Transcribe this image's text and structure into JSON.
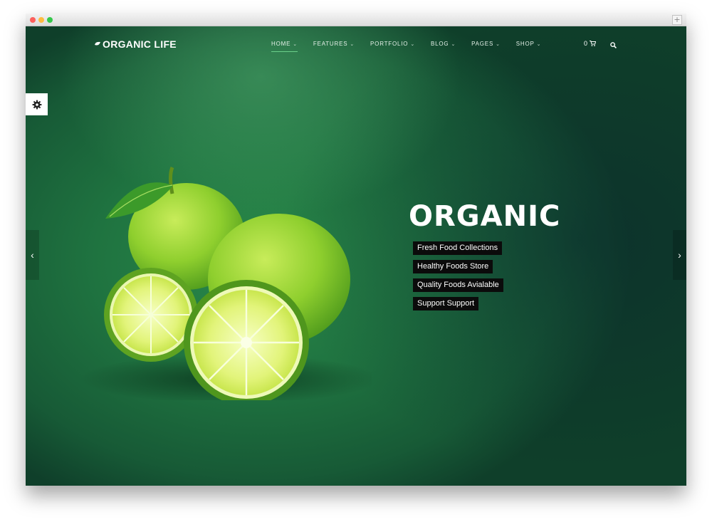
{
  "brand": {
    "logo_text": "ORGANIC LIFE"
  },
  "nav": {
    "items": [
      {
        "label": "HOME",
        "active": true
      },
      {
        "label": "FEATURES",
        "active": false
      },
      {
        "label": "PORTFOLIO",
        "active": false
      },
      {
        "label": "BLOG",
        "active": false
      },
      {
        "label": "PAGES",
        "active": false
      },
      {
        "label": "SHOP",
        "active": false
      }
    ],
    "chevron": "⌄"
  },
  "cart": {
    "count": "0",
    "icon": "cart-icon"
  },
  "search": {
    "icon": "search-icon"
  },
  "settings": {
    "icon": "gear-icon"
  },
  "slider": {
    "prev_icon": "chevron-left-icon",
    "next_icon": "chevron-right-icon",
    "prev_glyph": "‹",
    "next_glyph": "›"
  },
  "hero": {
    "title": "ORGANIC",
    "tags": [
      "Fresh Food Collections",
      "Healthy Foods Store",
      "Quality Foods Avialable",
      "Support Support"
    ]
  },
  "colors": {
    "background_green": "#1f7340",
    "accent_green": "#6bd08a",
    "tag_background": "#0b0b0b"
  }
}
